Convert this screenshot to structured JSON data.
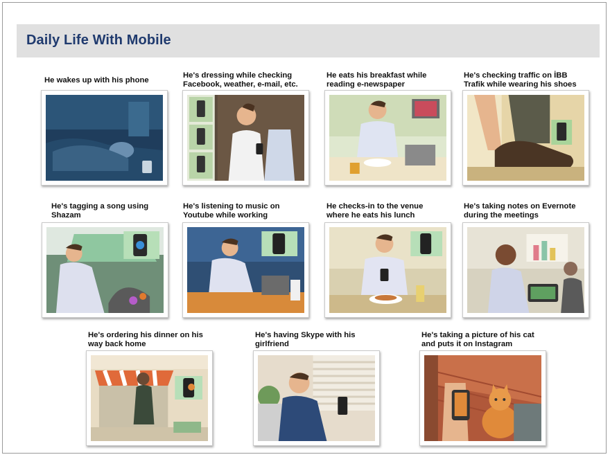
{
  "page": {
    "title": "Daily Life With Mobile"
  },
  "panels": [
    {
      "caption": "He wakes up with his phone",
      "icon": "waking-up-bedroom-scene"
    },
    {
      "caption": "He's dressing while checking\nFacebook, weather, e-mail, etc.",
      "icon": "dressing-phone-scene"
    },
    {
      "caption": "He eats his breakfast while\nreading e-newspaper",
      "icon": "breakfast-tablet-scene"
    },
    {
      "caption": "He's checking traffic on İBB\nTrafik while wearing his shoes",
      "icon": "shoes-traffic-app-scene"
    },
    {
      "caption": "He's tagging a song using\nShazam",
      "icon": "car-shazam-scene"
    },
    {
      "caption": "He's listening to music on\nYoutube while working",
      "icon": "office-youtube-scene"
    },
    {
      "caption": "He checks-in to the venue\nwhere he eats his lunch",
      "icon": "lunch-checkin-scene"
    },
    {
      "caption": "He's taking notes on Evernote\nduring the meetings",
      "icon": "meeting-evernote-scene"
    },
    {
      "caption": "He's ordering his dinner on his\nway back home",
      "icon": "street-dinner-order-scene"
    },
    {
      "caption": "He's having Skype with his\ngirlfriend",
      "icon": "home-skype-scene"
    },
    {
      "caption": "He's taking a picture of his cat\nand puts it on Instagram",
      "icon": "cat-instagram-scene"
    }
  ]
}
